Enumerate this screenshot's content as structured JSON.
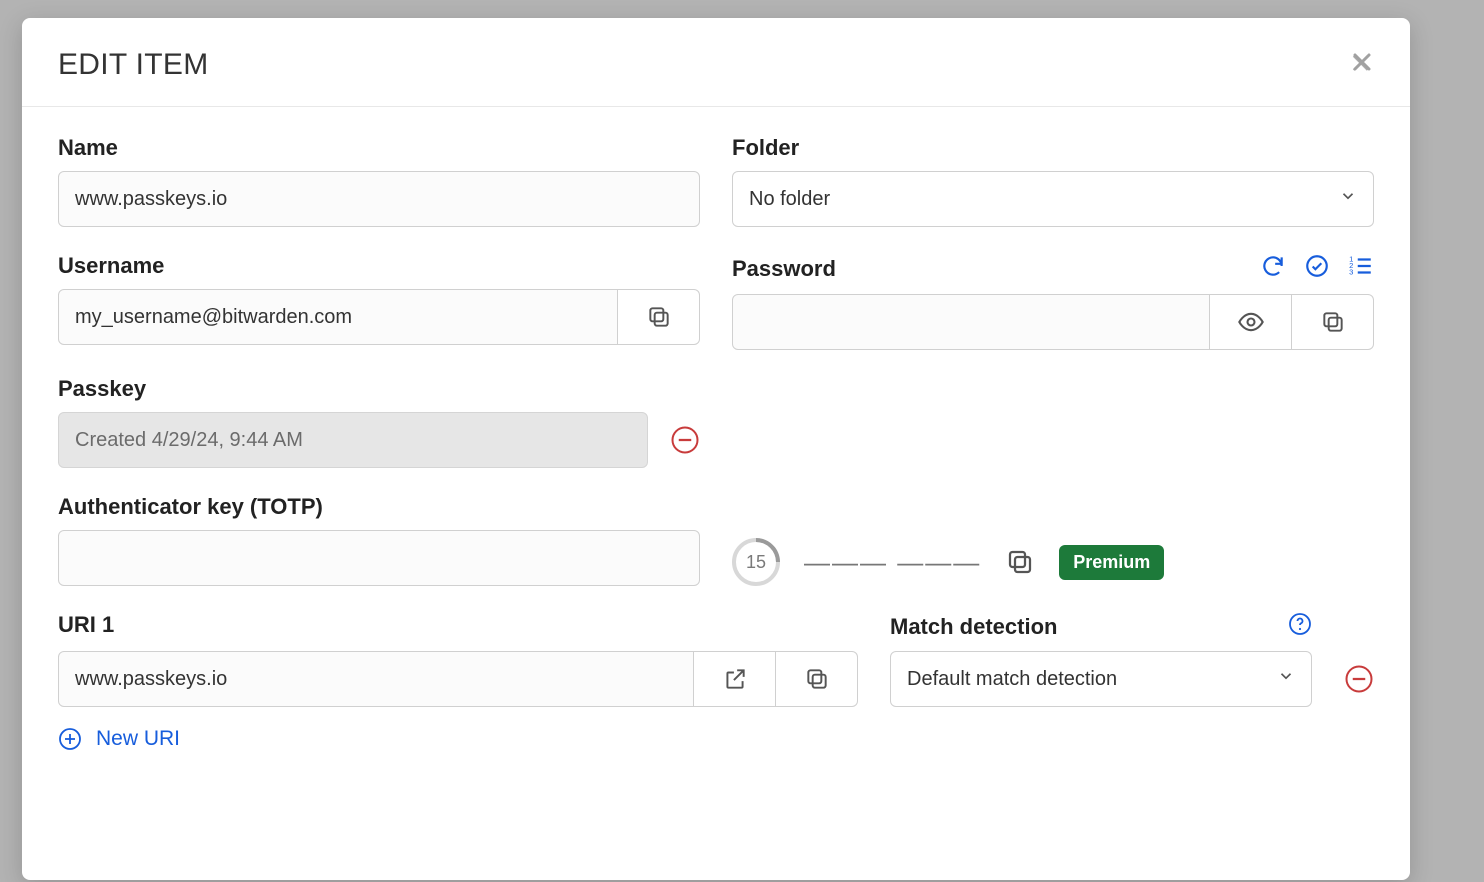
{
  "modal": {
    "title": "EDIT ITEM"
  },
  "name": {
    "label": "Name",
    "value": "www.passkeys.io"
  },
  "folder": {
    "label": "Folder",
    "selected": "No folder"
  },
  "username": {
    "label": "Username",
    "value": "my_username@bitwarden.com"
  },
  "password": {
    "label": "Password",
    "value": ""
  },
  "passkey": {
    "label": "Passkey",
    "created_text": "Created 4/29/24, 9:44 AM"
  },
  "totp": {
    "label": "Authenticator key (TOTP)",
    "value": "",
    "timer": "15",
    "code": "——— ———",
    "badge": "Premium"
  },
  "uri": {
    "label": "URI 1",
    "value": "www.passkeys.io",
    "match_label": "Match detection",
    "match_selected": "Default match detection",
    "new_uri_label": "New URI"
  }
}
